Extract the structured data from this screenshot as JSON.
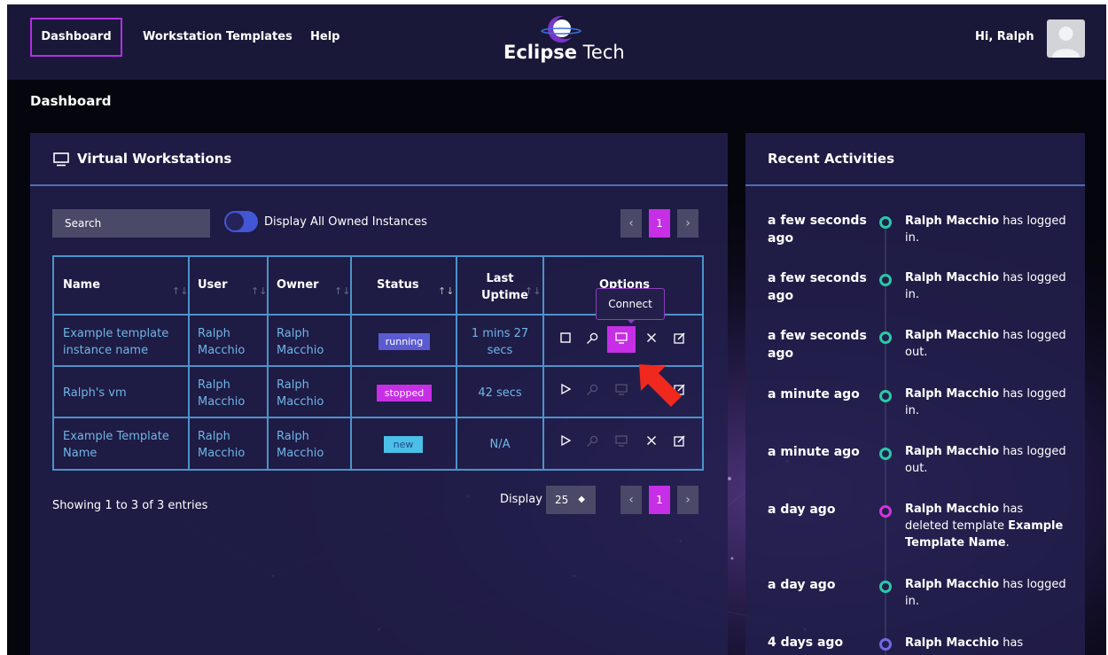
{
  "nav": {
    "links": [
      "Dashboard",
      "Workstation Templates",
      "Help"
    ],
    "logo_bold": "Eclipse",
    "logo_light": " Tech",
    "greeting": "Hi, Ralph"
  },
  "page_title": "Dashboard",
  "workstations": {
    "title": "Virtual Workstations",
    "search_placeholder": "Search",
    "toggle_label": "Display All Owned Instances",
    "current_page": "1",
    "columns": [
      "Name",
      "User",
      "Owner",
      "Status",
      "Last Uptime",
      "Options"
    ],
    "rows": [
      {
        "name": "Example template instance name",
        "user": "Ralph Macchio",
        "owner": "Ralph Macchio",
        "status": "running",
        "uptime": "1 mins 27 secs"
      },
      {
        "name": "Ralph's vm",
        "user": "Ralph Macchio",
        "owner": "Ralph Macchio",
        "status": "stopped",
        "uptime": "42 secs"
      },
      {
        "name": "Example Template Name",
        "user": "Ralph Macchio",
        "owner": "Ralph Macchio",
        "status": "new",
        "uptime": "N/A"
      }
    ],
    "tooltip": "Connect",
    "entries_info": "Showing 1 to 3 of 3 entries",
    "display_label": "Display",
    "display_value": "25"
  },
  "activities": {
    "title": "Recent Activities",
    "items": [
      {
        "time": "a few seconds ago",
        "user": "Ralph Macchio",
        "action": " has logged in.",
        "color": "#29c9a7"
      },
      {
        "time": "a few seconds ago",
        "user": "Ralph Macchio",
        "action": " has logged in.",
        "color": "#29c9a7"
      },
      {
        "time": "a few seconds ago",
        "user": "Ralph Macchio",
        "action": " has logged out.",
        "color": "#29c9a7"
      },
      {
        "time": "a minute ago",
        "user": "Ralph Macchio",
        "action": " has logged in.",
        "color": "#29c9a7"
      },
      {
        "time": "a minute ago",
        "user": "Ralph Macchio",
        "action": " has logged out.",
        "color": "#29c9a7"
      },
      {
        "time": "a day ago",
        "user": "Ralph Macchio",
        "action": " has deleted template ",
        "target": "Example Template Name",
        "suffix": ".",
        "color": "#d333dc"
      },
      {
        "time": "a day ago",
        "user": "Ralph Macchio",
        "action": " has logged in.",
        "color": "#29c9a7"
      },
      {
        "time": "4 days ago",
        "user": "Ralph Macchio",
        "action": " has",
        "color": "#6f6ae6"
      }
    ]
  },
  "colors": {
    "accent": "#c62fe5",
    "running": "#5a5ad1",
    "stopped": "#c62fe5",
    "new": "#4bbfe8",
    "link": "#6fb6e6"
  }
}
